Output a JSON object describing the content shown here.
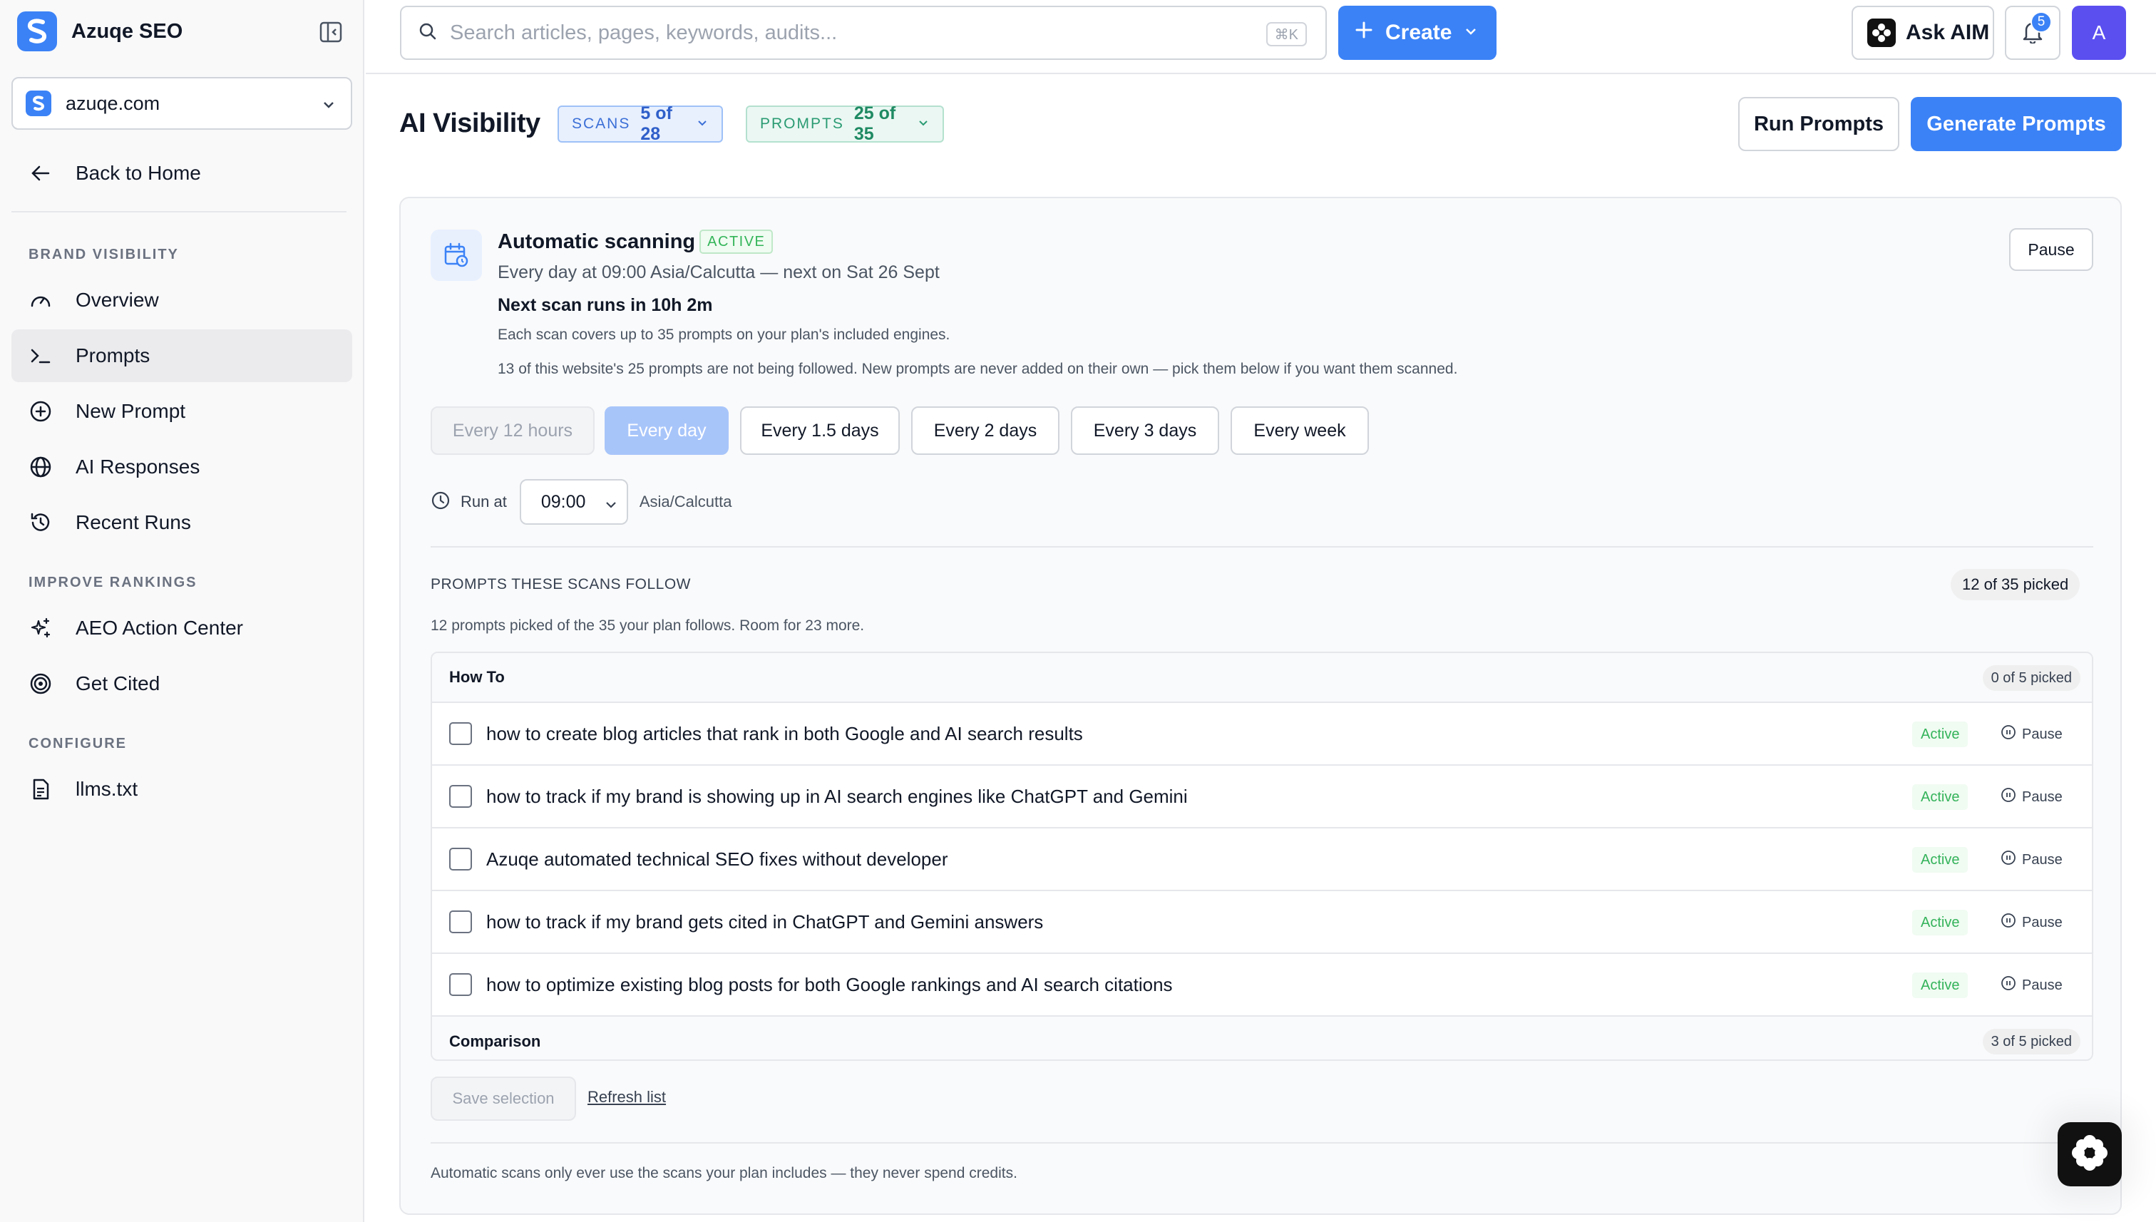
{
  "app": {
    "name": "Azuqe SEO"
  },
  "site_selector": {
    "value": "azuqe.com"
  },
  "sidebar": {
    "back_label": "Back to Home",
    "sections": [
      {
        "label": "BRAND VISIBILITY"
      },
      {
        "label": "IMPROVE RANKINGS"
      },
      {
        "label": "CONFIGURE"
      }
    ],
    "items": [
      {
        "label": "Overview",
        "icon": "gauge-icon",
        "active": false
      },
      {
        "label": "Prompts",
        "icon": "terminal-icon",
        "active": true
      },
      {
        "label": "New Prompt",
        "icon": "plus-circle-icon",
        "active": false
      },
      {
        "label": "AI Responses",
        "icon": "globe-icon",
        "active": false
      },
      {
        "label": "Recent Runs",
        "icon": "history-icon",
        "active": false
      },
      {
        "label": "AEO Action Center",
        "icon": "sparkles-icon",
        "active": false
      },
      {
        "label": "Get Cited",
        "icon": "target-icon",
        "active": false
      },
      {
        "label": "llms.txt",
        "icon": "file-icon",
        "active": false
      }
    ]
  },
  "topbar": {
    "search_placeholder": "Search articles, pages, keywords, audits...",
    "search_shortcut": "⌘K",
    "create_label": "Create",
    "ask_label": "Ask AIM",
    "notification_count": "5",
    "avatar_initial": "A"
  },
  "header": {
    "title": "AI Visibility",
    "scans_key": "SCANS",
    "scans_value": "5 of 28",
    "prompts_key": "PROMPTS",
    "prompts_value": "25 of 35",
    "run_label": "Run Prompts",
    "generate_label": "Generate Prompts"
  },
  "schedule": {
    "title": "Automatic scanning",
    "status": "ACTIVE",
    "schedule_line": "Every day at 09:00 Asia/Calcutta — next on Sat 26 Sept",
    "next_run": "Next scan runs in 10h 2m",
    "coverage_note": "Each scan covers up to 35 prompts on your plan's included engines.",
    "not_followed_note": "13 of this website's 25 prompts are not being followed. New prompts are never added on their own — pick them below if you want them scanned.",
    "pause_label": "Pause",
    "frequencies": [
      {
        "label": "Every 12 hours",
        "state": "disabled"
      },
      {
        "label": "Every day",
        "state": "selected"
      },
      {
        "label": "Every 1.5 days",
        "state": "normal"
      },
      {
        "label": "Every 2 days",
        "state": "normal"
      },
      {
        "label": "Every 3 days",
        "state": "normal"
      },
      {
        "label": "Every week",
        "state": "normal"
      }
    ],
    "run_at_label": "Run at",
    "run_at_time": "09:00",
    "timezone": "Asia/Calcutta"
  },
  "follow": {
    "title": "PROMPTS THESE SCANS FOLLOW",
    "picked_badge": "12 of 35 picked",
    "subtitle": "12 prompts picked of the 35 your plan follows. Room for 23 more.",
    "groups": [
      {
        "name": "How To",
        "count": "0 of 5 picked",
        "prompts": [
          {
            "text": "how to create blog articles that rank in both Google and AI search results",
            "status": "Active",
            "action": "Pause",
            "checked": false
          },
          {
            "text": "how to track if my brand is showing up in AI search engines like ChatGPT and Gemini",
            "status": "Active",
            "action": "Pause",
            "checked": false
          },
          {
            "text": "Azuqe automated technical SEO fixes without developer",
            "status": "Active",
            "action": "Pause",
            "checked": false
          },
          {
            "text": "how to track if my brand gets cited in ChatGPT and Gemini answers",
            "status": "Active",
            "action": "Pause",
            "checked": false
          },
          {
            "text": "how to optimize existing blog posts for both Google rankings and AI search citations",
            "status": "Active",
            "action": "Pause",
            "checked": false
          }
        ]
      },
      {
        "name": "Comparison",
        "count": "3 of 5 picked",
        "prompts": []
      }
    ],
    "save_label": "Save selection",
    "refresh_label": "Refresh list",
    "footnote": "Automatic scans only ever use the scans your plan includes — they never spend credits."
  },
  "colors": {
    "accent": "#3b82f6",
    "active_green": "#34b35a",
    "avatar": "#5b4ff0"
  }
}
